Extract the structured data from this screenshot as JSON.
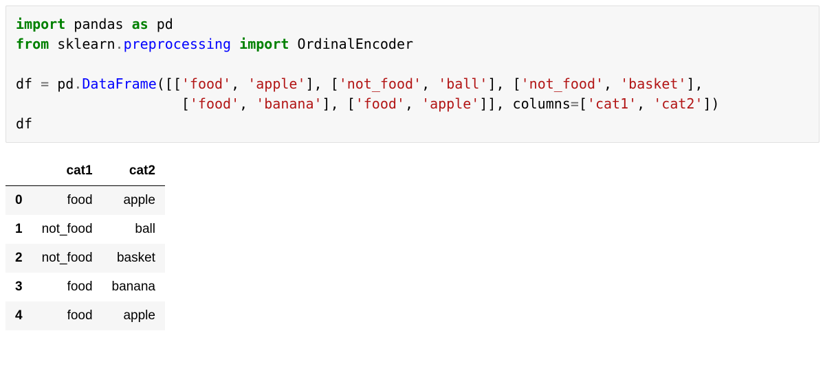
{
  "code": {
    "line1": {
      "kw_import": "import",
      "mod": "pandas",
      "kw_as": "as",
      "alias": "pd"
    },
    "line2": {
      "kw_from": "from",
      "mod1": "sklearn",
      "dot": ".",
      "mod2": "preprocessing",
      "kw_import": "import",
      "name": "OrdinalEncoder"
    },
    "line4": {
      "lhs": "df",
      "eq": "=",
      "obj": "pd",
      "dot": ".",
      "fn": "DataFrame",
      "open": "([[",
      "s1": "'food'",
      "c1": ",",
      "s2": "'apple'",
      "b1": "], [",
      "s3": "'not_food'",
      "c2": ",",
      "s4": "'ball'",
      "b2": "], [",
      "s5": "'not_food'",
      "c3": ",",
      "s6": "'basket'",
      "b3": "],"
    },
    "line5": {
      "indent": "                    [",
      "s7": "'food'",
      "c4": ",",
      "s8": "'banana'",
      "b4": "], [",
      "s9": "'food'",
      "c5": ",",
      "s10": "'apple'",
      "b5": "]],",
      "kw_columns": "columns",
      "eq2": "=",
      "colopen": "[",
      "c_s1": "'cat1'",
      "cc": ",",
      "c_s2": "'cat2'",
      "colclose": "])"
    },
    "line6": {
      "expr": "df"
    }
  },
  "table": {
    "columns": [
      "cat1",
      "cat2"
    ],
    "rows": [
      {
        "idx": "0",
        "cat1": "food",
        "cat2": "apple"
      },
      {
        "idx": "1",
        "cat1": "not_food",
        "cat2": "ball"
      },
      {
        "idx": "2",
        "cat1": "not_food",
        "cat2": "basket"
      },
      {
        "idx": "3",
        "cat1": "food",
        "cat2": "banana"
      },
      {
        "idx": "4",
        "cat1": "food",
        "cat2": "apple"
      }
    ]
  }
}
